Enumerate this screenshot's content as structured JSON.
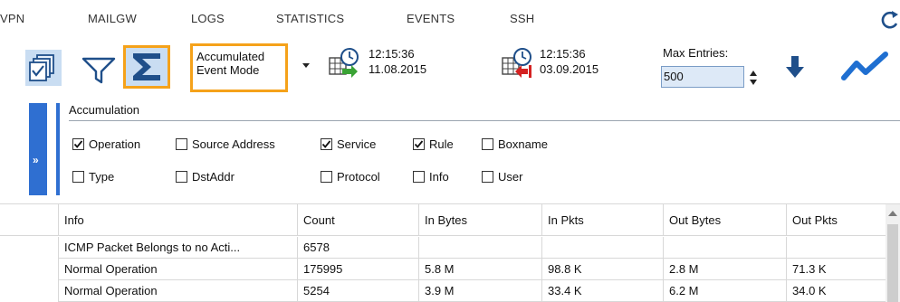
{
  "nav": {
    "tabs": [
      "VPN",
      "MAILGW",
      "LOGS",
      "STATISTICS",
      "EVENTS",
      "SSH"
    ],
    "refresh_icon": "refresh-icon"
  },
  "toolbar": {
    "icons": [
      "copy-pages-icon",
      "filter-funnel-icon",
      "sigma-icon",
      "calendar-clock-start-icon",
      "calendar-clock-end-icon",
      "download-arrow-icon",
      "trend-chart-icon"
    ],
    "mode_line1": "Accumulated",
    "mode_line2": "Event Mode",
    "start_time": "12:15:36",
    "start_date": "11.08.2015",
    "end_time": "12:15:36",
    "end_date": "03.09.2015",
    "max_entries_label": "Max Entries:",
    "max_entries_value": "500",
    "accent_color": "#f5a21a",
    "selected_bg": "#c9ddf2"
  },
  "accumulation": {
    "title": "Accumulation",
    "expand_label": "»",
    "options": [
      {
        "label": "Operation",
        "checked": true
      },
      {
        "label": "Source Address",
        "checked": false
      },
      {
        "label": "Service",
        "checked": true
      },
      {
        "label": "Rule",
        "checked": true
      },
      {
        "label": "Boxname",
        "checked": false
      },
      {
        "label": "Type",
        "checked": false
      },
      {
        "label": "DstAddr",
        "checked": false
      },
      {
        "label": "Protocol",
        "checked": false
      },
      {
        "label": "Info",
        "checked": false
      },
      {
        "label": "User",
        "checked": false
      }
    ],
    "panel_color": "#2f6fd1"
  },
  "grid": {
    "columns": [
      "Info",
      "Count",
      "In Bytes",
      "In Pkts",
      "Out Bytes",
      "Out Pkts"
    ],
    "rows": [
      [
        "ICMP Packet Belongs to no Acti...",
        "6578",
        "",
        "",
        "",
        ""
      ],
      [
        "Normal Operation",
        "175995",
        "5.8 M",
        "98.8 K",
        "2.8 M",
        "71.3 K"
      ],
      [
        "Normal Operation",
        "5254",
        "3.9 M",
        "33.4 K",
        "6.2 M",
        "34.0 K"
      ]
    ]
  }
}
